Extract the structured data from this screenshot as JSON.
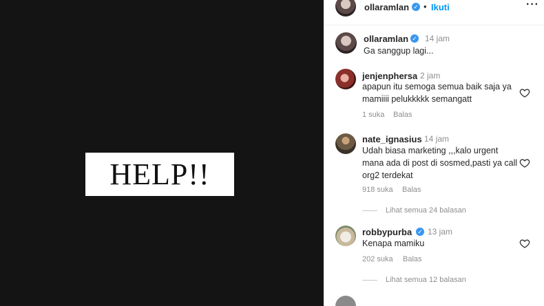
{
  "media": {
    "image_text": "HELP!!"
  },
  "header": {
    "username": "ollaramlan",
    "separator": "•",
    "follow_label": "Ikuti",
    "more_icon": "more-horizontal-icon"
  },
  "caption": {
    "username": "ollaramlan",
    "time": "14 jam",
    "text": "Ga sanggup lagi..."
  },
  "comments": [
    {
      "username": "jenjenphersa",
      "time": "2 jam",
      "verified": false,
      "text": "apapun itu semoga semua baik saja ya mamiiii pelukkkkk semangatt",
      "likes": "1 suka",
      "reply_label": "Balas"
    },
    {
      "username": "nate_ignasius",
      "time": "14 jam",
      "verified": false,
      "text": "Udah biasa marketing ,,,kalo urgent mana ada di post di sosmed,pasti ya call org2 terdekat",
      "likes": "918 suka",
      "reply_label": "Balas",
      "view_replies": "Lihat semua 24 balasan"
    },
    {
      "username": "robbypurba",
      "time": "13 jam",
      "verified": true,
      "text": "Kenapa mamiku",
      "likes": "202 suka",
      "reply_label": "Balas",
      "view_replies": "Lihat semua 12 balasan"
    }
  ],
  "colors": {
    "link": "#0095f6",
    "verified": "#3897f0",
    "muted": "#8e8e8e",
    "media_bg": "#141414"
  }
}
